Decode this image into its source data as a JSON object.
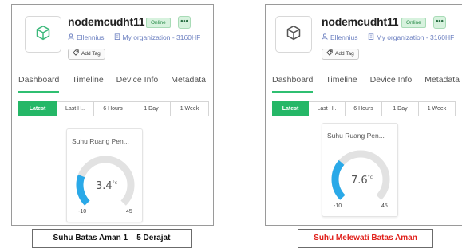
{
  "panels": [
    {
      "device_name": "nodemcudht11",
      "status": "Online",
      "more": "•••",
      "owner": "Ellennius",
      "organization": "My organization - 3160HF",
      "add_tag": "Add Tag",
      "tabs": [
        "Dashboard",
        "Timeline",
        "Device Info",
        "Metadata"
      ],
      "active_tab": "Dashboard",
      "time_ranges": [
        "Latest",
        "Last H..",
        "6 Hours",
        "1 Day",
        "1 Week"
      ],
      "active_range": "Latest",
      "gauge": {
        "title": "Suhu Ruang Pen...",
        "value": "3.4",
        "unit": "°c",
        "min": "-10",
        "max": "45",
        "numeric_value": 3.4,
        "numeric_min": -10,
        "numeric_max": 45
      },
      "caption": "Suhu Batas Aman 1 – 5 Derajat"
    },
    {
      "device_name": "nodemcudht11",
      "status": "Online",
      "more": "•••",
      "owner": "Ellennius",
      "organization": "My organization - 3160HF",
      "add_tag": "Add Tag",
      "tabs": [
        "Dashboard",
        "Timeline",
        "Device Info",
        "Metadata"
      ],
      "active_tab": "Dashboard",
      "time_ranges": [
        "Latest",
        "Last H..",
        "6 Hours",
        "1 Day",
        "1 Week"
      ],
      "active_range": "Latest",
      "gauge": {
        "title": "Suhu Ruang Pen...",
        "value": "7.6",
        "unit": "°c",
        "min": "-10",
        "max": "45",
        "numeric_value": 7.6,
        "numeric_min": -10,
        "numeric_max": 45
      },
      "caption": "Suhu Melewati Batas Aman"
    }
  ],
  "colors": {
    "accent_green": "#25b767",
    "gauge_fill": "#2aa9e8",
    "gauge_track": "#e2e2e2",
    "caption_alert": "#e0201b",
    "link_blue": "#6b7fc0"
  },
  "icons": {
    "device": "cube-icon",
    "owner": "user-icon",
    "organization": "building-icon",
    "tag": "tag-icon"
  }
}
